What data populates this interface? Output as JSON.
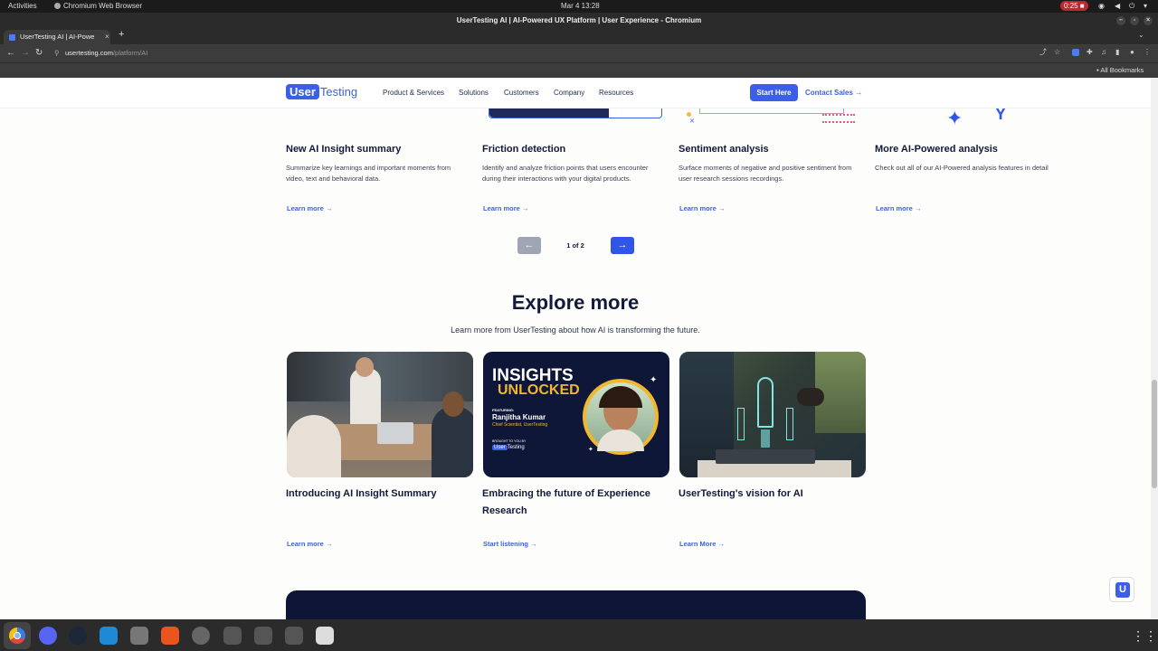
{
  "os": {
    "activities": "Activities",
    "app_name": "Chromium Web Browser",
    "clock": "Mar 4  13:28",
    "record_time": "0:25"
  },
  "window": {
    "title": "UserTesting AI | AI-Powered UX Platform | User Experience - Chromium"
  },
  "tabs": [
    {
      "label": "UserTesting AI | AI-Powe"
    }
  ],
  "address": {
    "domain": "usertesting.com",
    "path": "/platform/AI"
  },
  "bookmarks": {
    "all_label": "All Bookmarks"
  },
  "site": {
    "logo_user": "User",
    "logo_testing": "Testing",
    "menu": [
      "Product & Services",
      "Solutions",
      "Customers",
      "Company",
      "Resources"
    ],
    "start_here": "Start Here",
    "contact_sales": "Contact Sales"
  },
  "features": [
    {
      "title": "New AI Insight summary",
      "desc": "Summarize key learnings and important moments from video, text and behavioral data.",
      "link": "Learn more"
    },
    {
      "title": "Friction detection",
      "desc": "Identify and analyze friction points that users encounter during their interactions with your digital products.",
      "link": "Learn more"
    },
    {
      "title": "Sentiment analysis",
      "desc": "Surface moments of negative and positive sentiment from user research sessions recordings.",
      "link": "Learn more"
    },
    {
      "title": "More AI-Powered analysis",
      "desc": "Check out all of our AI-Powered analysis features in detail",
      "link": "Learn more"
    }
  ],
  "pager": {
    "text": "1 of 2"
  },
  "explore": {
    "heading": "Explore more",
    "subtitle": "Learn more from UserTesting about how AI is transforming the future.",
    "cards": [
      {
        "title": "Introducing AI Insight Summary",
        "link": "Learn more"
      },
      {
        "title": "Embracing the future of Experience Research",
        "link": "Start listening"
      },
      {
        "title": "UserTesting's vision for AI",
        "link": "Learn More"
      }
    ],
    "podcast": {
      "line1": "INSIGHTS",
      "line2": "UNLOCKED",
      "featuring": "FEATURING:",
      "name": "Ranjitha Kumar",
      "role": "Chief Scientist, UserTesting",
      "brought": "BROUGHT TO YOU BY"
    }
  },
  "chat": {
    "letter": "U"
  }
}
